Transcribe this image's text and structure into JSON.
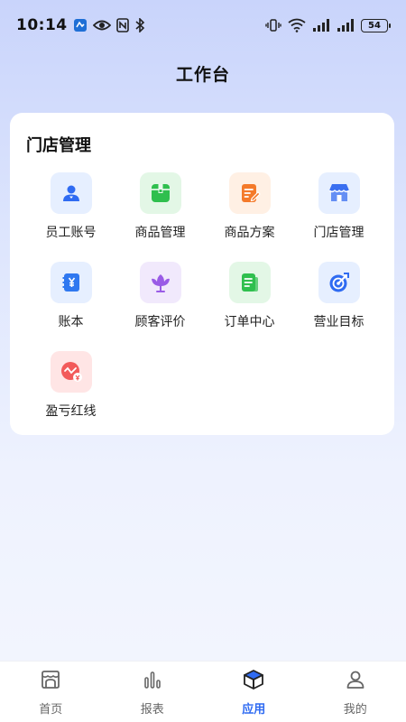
{
  "status_bar": {
    "time": "10:14",
    "battery": "54"
  },
  "header": {
    "title": "工作台"
  },
  "section": {
    "title": "门店管理",
    "items": [
      {
        "label": "员工账号",
        "icon": "employee-account-icon",
        "bg": "#e6efff",
        "color": "#2f6bf2"
      },
      {
        "label": "商品管理",
        "icon": "product-box-icon",
        "bg": "#e3f7e6",
        "color": "#2fbf4e"
      },
      {
        "label": "商品方案",
        "icon": "product-plan-icon",
        "bg": "#fff0e4",
        "color": "#f47a2a"
      },
      {
        "label": "门店管理",
        "icon": "store-icon",
        "bg": "#e6efff",
        "color": "#3a6ff0"
      },
      {
        "label": "账本",
        "icon": "ledger-icon",
        "bg": "#e6efff",
        "color": "#2f78f0"
      },
      {
        "label": "顾客评价",
        "icon": "customer-review-icon",
        "bg": "#f1e9fc",
        "color": "#9a5ce6"
      },
      {
        "label": "订单中心",
        "icon": "order-center-icon",
        "bg": "#e3f7e6",
        "color": "#2fbf4e"
      },
      {
        "label": "营业目标",
        "icon": "business-target-icon",
        "bg": "#e6efff",
        "color": "#2f6bf2"
      },
      {
        "label": "盈亏红线",
        "icon": "profit-loss-icon",
        "bg": "#ffe5e5",
        "color": "#f25a5a"
      }
    ]
  },
  "tabbar": {
    "active_color": "#2f6bf2",
    "items": [
      {
        "label": "首页",
        "icon": "home-icon"
      },
      {
        "label": "报表",
        "icon": "report-icon"
      },
      {
        "label": "应用",
        "icon": "apps-cube-icon",
        "active": true
      },
      {
        "label": "我的",
        "icon": "profile-icon"
      }
    ]
  }
}
